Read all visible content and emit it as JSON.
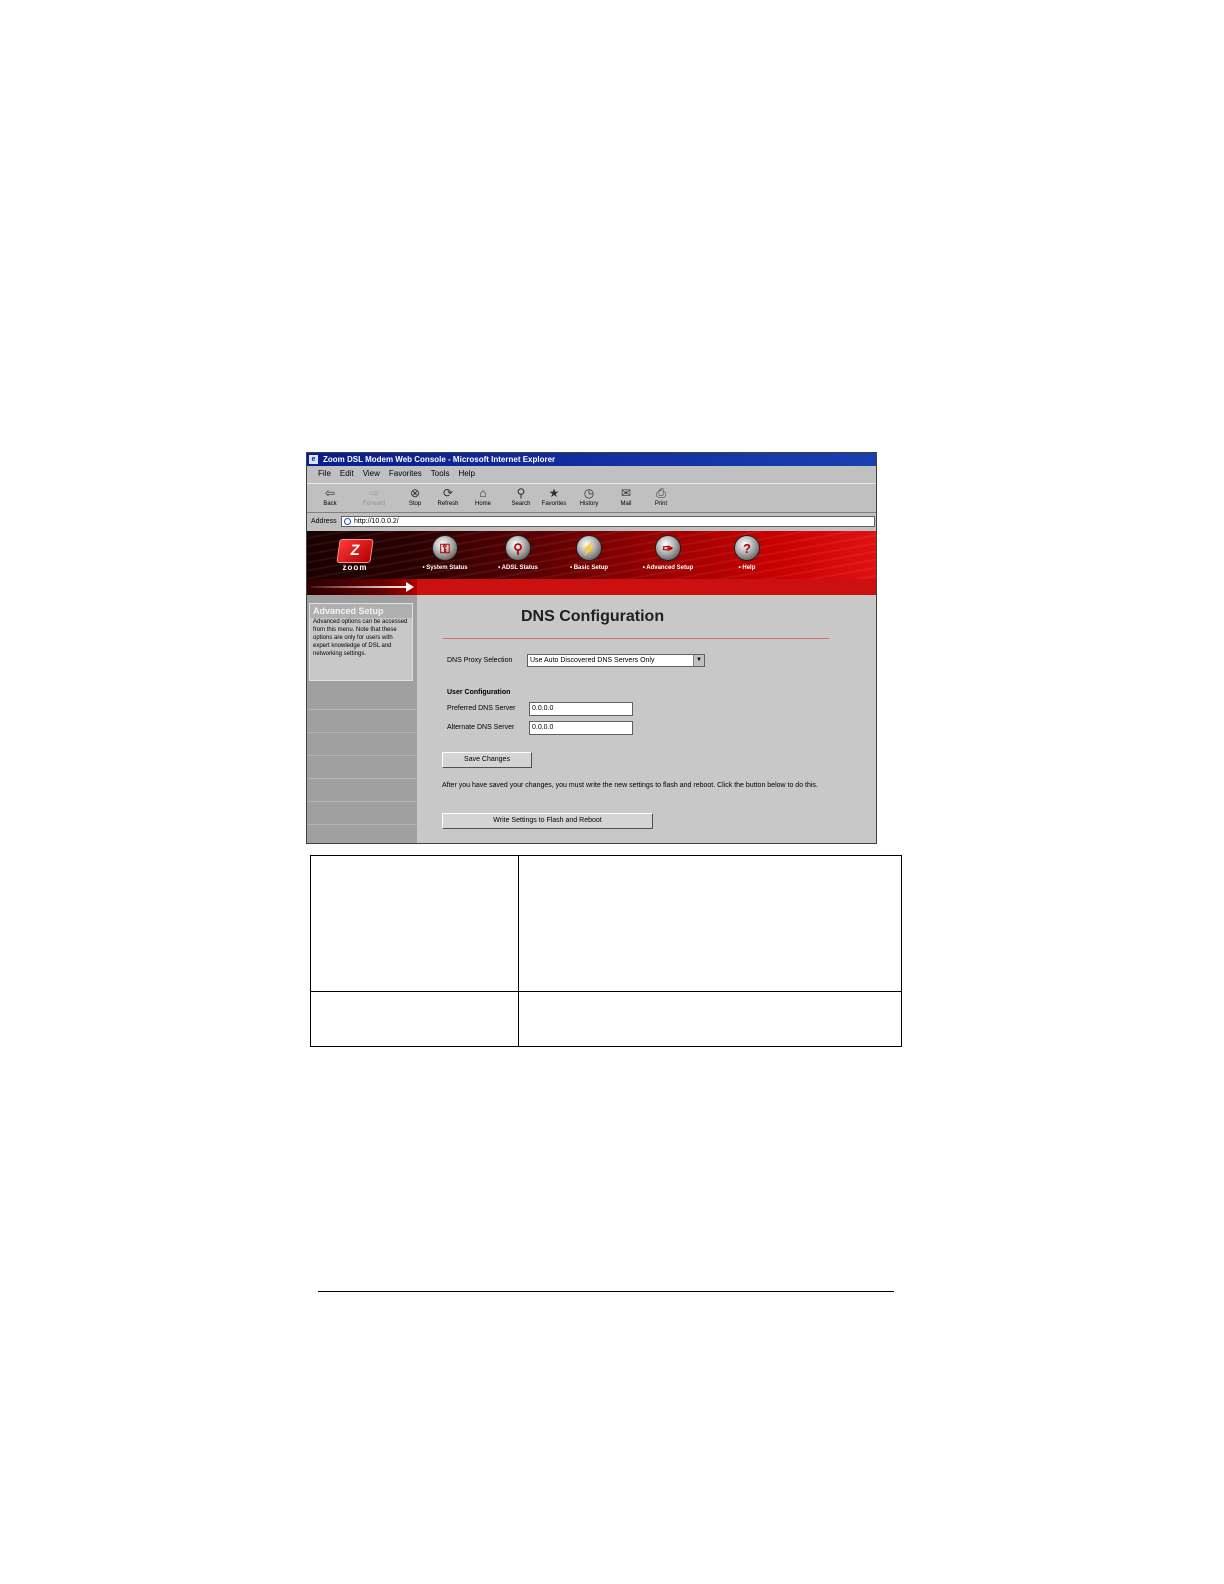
{
  "browser": {
    "title": "Zoom DSL Modem Web Console - Microsoft Internet Explorer",
    "menu": [
      "File",
      "Edit",
      "View",
      "Favorites",
      "Tools",
      "Help"
    ],
    "toolbar": [
      {
        "label": "Back",
        "icon": "back-arrow-icon",
        "glyph": "⇦"
      },
      {
        "label": "Forward",
        "icon": "forward-arrow-icon",
        "glyph": "⇨"
      },
      {
        "label": "Stop",
        "icon": "stop-icon",
        "glyph": "⊗"
      },
      {
        "label": "Refresh",
        "icon": "refresh-icon",
        "glyph": "⟳"
      },
      {
        "label": "Home",
        "icon": "home-icon",
        "glyph": "⌂"
      },
      {
        "label": "Search",
        "icon": "search-icon",
        "glyph": "⚲"
      },
      {
        "label": "Favorites",
        "icon": "favorites-icon",
        "glyph": "★"
      },
      {
        "label": "History",
        "icon": "history-icon",
        "glyph": "◷"
      },
      {
        "label": "Mail",
        "icon": "mail-icon",
        "glyph": "✉"
      },
      {
        "label": "Print",
        "icon": "print-icon",
        "glyph": "⎙"
      }
    ],
    "address_label": "Address",
    "address_value": "http://10.0.0.2/"
  },
  "header": {
    "logo_text": "zoom",
    "nav": [
      {
        "label": "• System Status",
        "icon": "lock-icon",
        "glyph": "🔒"
      },
      {
        "label": "• ADSL Status",
        "icon": "magnifier-icon",
        "glyph": "⚲"
      },
      {
        "label": "• Basic Setup",
        "icon": "plug-icon",
        "glyph": "✎"
      },
      {
        "label": "• Advanced Setup",
        "icon": "wrench-icon",
        "glyph": "✖"
      },
      {
        "label": "• Help",
        "icon": "help-icon",
        "glyph": "?"
      }
    ]
  },
  "sidebar": {
    "title": "Advanced Setup",
    "text": "Advanced options can be accessed from this menu. Note that these options are only for users with expert knowledge of DSL and networking settings."
  },
  "main": {
    "title": "DNS Configuration",
    "proxy_label": "DNS Proxy Selection",
    "proxy_value": "Use Auto Discovered DNS Servers Only",
    "user_config_label": "User Configuration",
    "preferred_label": "Preferred DNS Server",
    "preferred_value": "0.0.0.0",
    "alternate_label": "Alternate DNS Server",
    "alternate_value": "0.0.0.0",
    "save_button": "Save Changes",
    "note": "After you have saved your changes, you must write the new settings to flash and reboot. Click the button below to do this.",
    "write_button": "Write Settings to Flash and Reboot"
  },
  "colors": {
    "header_red": "#cc1010",
    "title_bar_blue": "#0a1e8c",
    "panel_gray": "#c8c8c8"
  }
}
